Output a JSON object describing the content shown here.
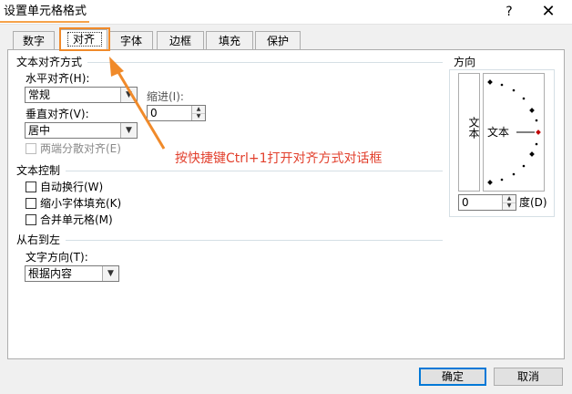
{
  "dialog": {
    "title": "设置单元格格式",
    "help_label": "?",
    "close_label": "✕"
  },
  "tabs": [
    {
      "label": "数字"
    },
    {
      "label": "对齐",
      "active": true
    },
    {
      "label": "字体"
    },
    {
      "label": "边框"
    },
    {
      "label": "填充"
    },
    {
      "label": "保护"
    }
  ],
  "alignment": {
    "group_title": "文本对齐方式",
    "horizontal_label": "水平对齐(H):",
    "horizontal_value": "常规",
    "indent_label": "缩进(I):",
    "indent_value": "0",
    "vertical_label": "垂直对齐(V):",
    "vertical_value": "居中",
    "distributed_label": "两端分散对齐(E)"
  },
  "text_control": {
    "group_title": "文本控制",
    "wrap_label": "自动换行(W)",
    "shrink_label": "缩小字体填充(K)",
    "merge_label": "合并单元格(M)"
  },
  "rtl": {
    "group_title": "从右到左",
    "direction_label": "文字方向(T):",
    "direction_value": "根据内容"
  },
  "orientation": {
    "group_title": "方向",
    "vertical_text": "文本",
    "dial_text": "文本",
    "degrees_value": "0",
    "degrees_label": "度(D)"
  },
  "annotation": {
    "text": "按快捷键Ctrl+1打开对齐方式对话框",
    "color": "#e2402d"
  },
  "buttons": {
    "ok_label": "确定",
    "cancel_label": "取消"
  },
  "colors": {
    "highlight": "#f08a2a",
    "default_button_border": "#0078d7"
  }
}
